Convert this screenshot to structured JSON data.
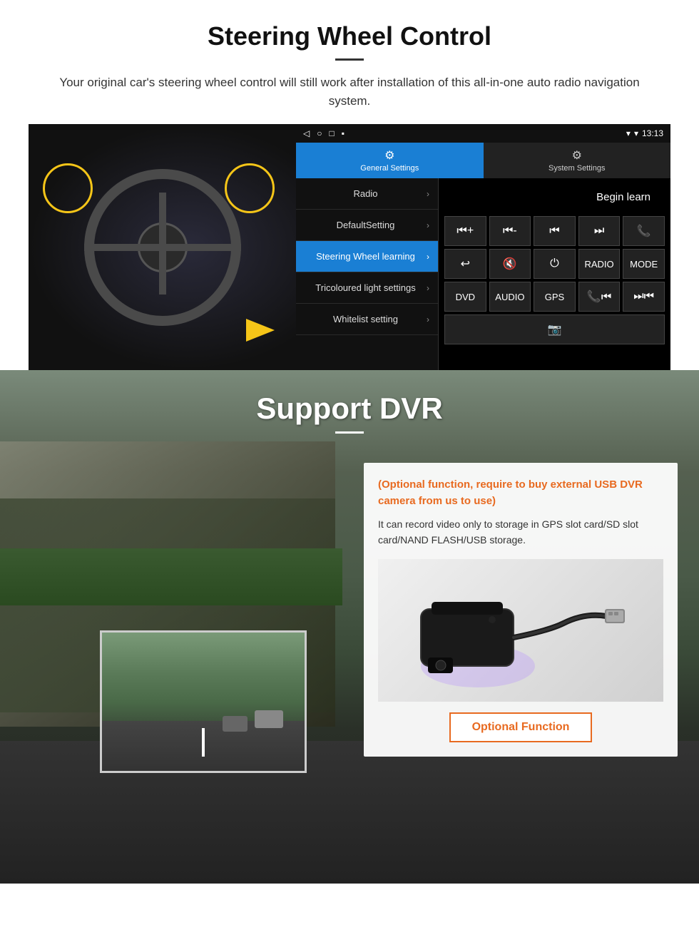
{
  "page": {
    "section1": {
      "title": "Steering Wheel Control",
      "subtitle": "Your original car's steering wheel control will still work after installation of this all-in-one auto radio navigation system.",
      "android": {
        "statusbar": {
          "nav_back": "◁",
          "nav_home": "○",
          "nav_square": "□",
          "nav_menu": "▪",
          "signal": "▾",
          "wifi": "▾",
          "time": "13:13"
        },
        "tabs": {
          "general": {
            "icon": "⚙",
            "label": "General Settings"
          },
          "system": {
            "icon": "🔧",
            "label": "System Settings"
          }
        },
        "menu_items": [
          {
            "label": "Radio",
            "active": false
          },
          {
            "label": "DefaultSetting",
            "active": false
          },
          {
            "label": "Steering Wheel learning",
            "active": true
          },
          {
            "label": "Tricoloured light settings",
            "active": false
          },
          {
            "label": "Whitelist setting",
            "active": false
          }
        ],
        "begin_learn": "Begin learn",
        "control_buttons": [
          [
            "⏮+",
            "⏮-",
            "⏮⏮",
            "⏭⏭",
            "📞"
          ],
          [
            "↩",
            "🔇",
            "⏻",
            "RADIO",
            "MODE"
          ],
          [
            "DVD",
            "AUDIO",
            "GPS",
            "📞⏮⏭",
            "⏮⏭"
          ]
        ],
        "control_buttons_row4": [
          "📷"
        ]
      }
    },
    "section2": {
      "title": "Support DVR",
      "optional_text": "(Optional function, require to buy external USB DVR camera from us to use)",
      "desc_text": "It can record video only to storage in GPS slot card/SD slot card/NAND FLASH/USB storage.",
      "optional_button": "Optional Function"
    }
  }
}
